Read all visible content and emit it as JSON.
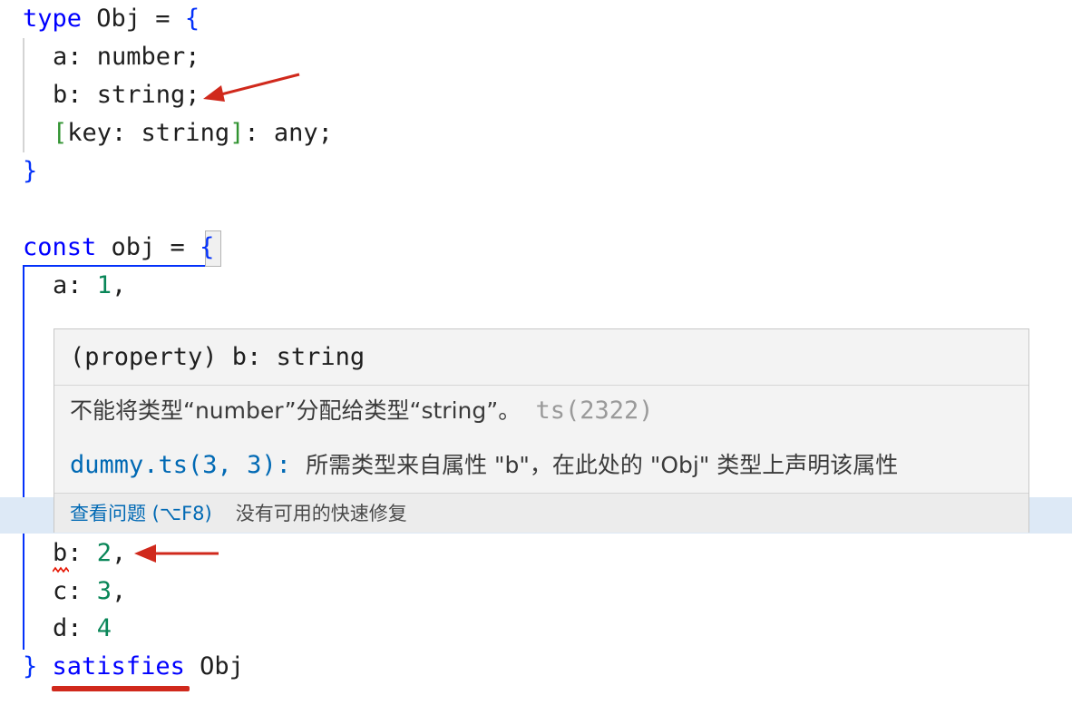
{
  "code": {
    "type_kw": "type",
    "type_name": " Obj = ",
    "open_brace": "{",
    "close_brace": "}",
    "line_a": "a: number;",
    "line_b": "b: string;",
    "idx_open": "[",
    "idx_body": "key: string",
    "idx_close": "]",
    "idx_rest": ": any;",
    "const_kw": "const",
    "const_rest": " obj = ",
    "prop_a": "a: ",
    "val_a": "1",
    "comma": ",",
    "prop_b": "b",
    "colon": ": ",
    "val_b": "2",
    "prop_c": "c: ",
    "val_c": "3",
    "prop_d": "d: ",
    "val_d": "4",
    "satisfies_kw": "satisfies",
    "satisfies_type": "Obj"
  },
  "hover": {
    "signature": "(property) b: string",
    "error_message": "不能将类型“number”分配给类型“string”。",
    "error_code": "ts(2322)",
    "related_link": "dummy.ts(3, 3):",
    "related_text": "所需类型来自属性 \"b\"，在此处的 \"Obj\" 类型上声明该属性",
    "view_problem": "查看问题 (⌥F8)",
    "no_quick_fix": "没有可用的快速修复"
  },
  "colors": {
    "keyword": "#0000ff",
    "number": "#098658",
    "annotation_red": "#d0291c",
    "link": "#0069b4"
  }
}
